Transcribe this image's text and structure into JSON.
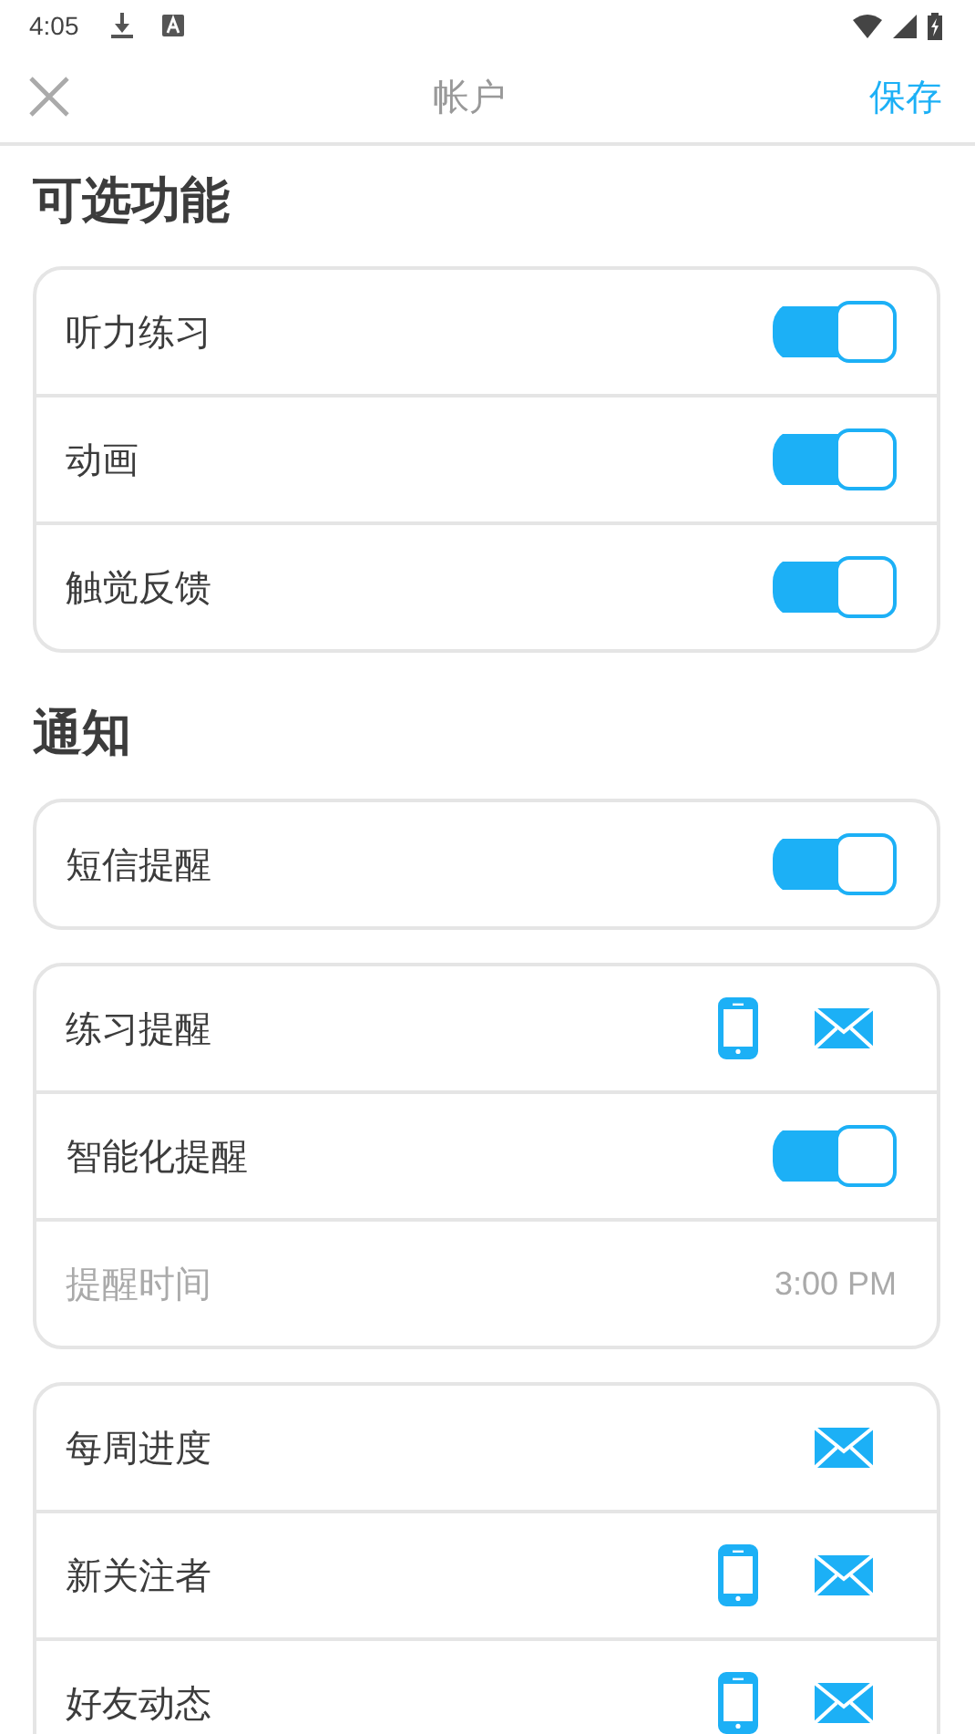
{
  "status_bar": {
    "time": "4:05"
  },
  "header": {
    "title": "帐户",
    "save": "保存"
  },
  "sections": [
    {
      "title": "可选功能",
      "cards": [
        {
          "rows": [
            {
              "kind": "toggle",
              "label": "听力练习",
              "on": true
            },
            {
              "kind": "toggle",
              "label": "动画",
              "on": true
            },
            {
              "kind": "toggle",
              "label": "触觉反馈",
              "on": true
            }
          ]
        }
      ]
    },
    {
      "title": "通知",
      "cards": [
        {
          "rows": [
            {
              "kind": "toggle",
              "label": "短信提醒",
              "on": true
            }
          ]
        },
        {
          "rows": [
            {
              "kind": "channels",
              "label": "练习提醒",
              "phone": true,
              "email": true
            },
            {
              "kind": "toggle",
              "label": "智能化提醒",
              "on": true
            },
            {
              "kind": "time",
              "label": "提醒时间",
              "value": "3:00 PM"
            }
          ]
        },
        {
          "rows": [
            {
              "kind": "channels",
              "label": "每周进度",
              "phone": false,
              "email": true
            },
            {
              "kind": "channels",
              "label": "新关注者",
              "phone": true,
              "email": true
            },
            {
              "kind": "channels",
              "label": "好友动态",
              "phone": true,
              "email": true
            }
          ]
        }
      ]
    }
  ]
}
